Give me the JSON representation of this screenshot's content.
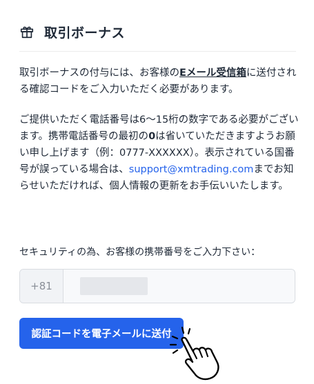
{
  "header": {
    "title": "取引ボーナス",
    "icon": "gift-icon"
  },
  "notice": {
    "p1_a": "取引ボーナスの付与には、お客様の",
    "p1_link": "Eメール受信箱",
    "p1_b": "に送付される確認コードをご入力いただく必要があります。",
    "p2_a": "ご提供いただく電話番号は6～15桁の数字である必要がございます。携帯電話番号の最初の",
    "p2_zero": "0",
    "p2_b": "は省いていただきますようお願い申し上げます（例：0777-XXXXXX）。表示されている国番号が誤っている場合は、",
    "p2_email": "support@xmtrading.com",
    "p2_c": "までお知らせいただければ、個人情報の更新をお手伝いいたします。"
  },
  "form": {
    "prompt": "セキュリティの為、お客様の携帯番号をご入力下さい：",
    "country_code": "+81",
    "phone_value": "",
    "send_button": "認証コードを電子メールに送付"
  },
  "colors": {
    "accent": "#2563eb",
    "text": "#1f2937"
  }
}
